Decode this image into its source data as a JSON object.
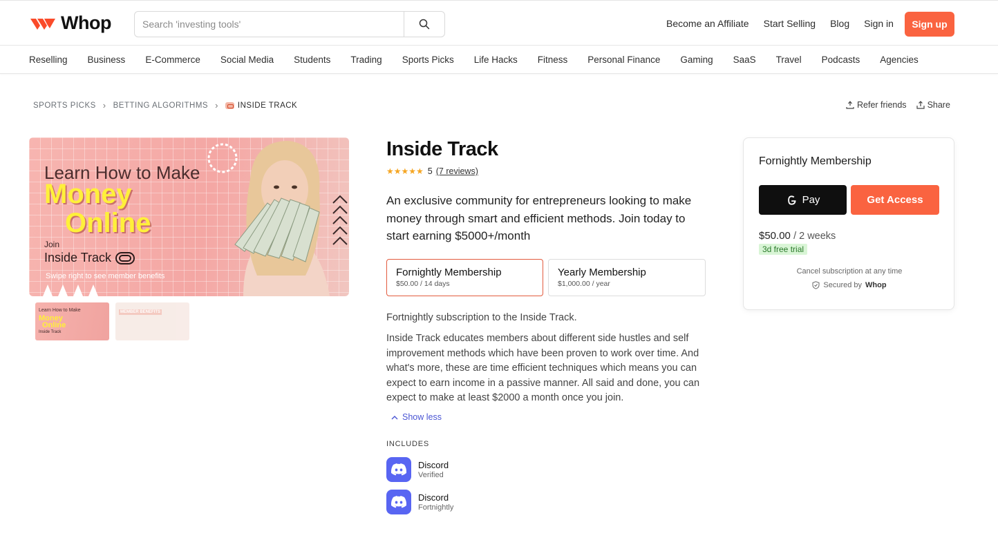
{
  "header": {
    "logo_text": "Whop",
    "search_placeholder": "Search 'investing tools'",
    "nav": [
      "Become an Affiliate",
      "Start Selling",
      "Blog",
      "Sign in"
    ],
    "signup_label": "Sign up",
    "accent_color": "#fa6340"
  },
  "categories": [
    "Reselling",
    "Business",
    "E-Commerce",
    "Social Media",
    "Students",
    "Trading",
    "Sports Picks",
    "Life Hacks",
    "Fitness",
    "Personal Finance",
    "Gaming",
    "SaaS",
    "Travel",
    "Podcasts",
    "Agencies"
  ],
  "breadcrumb": [
    "SPORTS PICKS",
    "BETTING ALGORITHMS",
    "INSIDE TRACK"
  ],
  "actions": {
    "refer": "Refer friends",
    "share": "Share"
  },
  "hero": {
    "line1": "Learn How to Make",
    "money": "Money",
    "online": "Online",
    "join": "Join",
    "track": "Inside Track",
    "swipe": "Swipe right to see member benefits"
  },
  "thumbs": {
    "t1a": "Learn How to Make",
    "t1b": "Money",
    "t1c": "Online",
    "t1d": "Inside Track",
    "t2a": "MEMBER BENEFITS"
  },
  "product": {
    "title": "Inside Track",
    "rating": "5",
    "reviews": "(7 reviews)",
    "tagline": "An exclusive community for entrepreneurs looking to make money through smart and efficient methods. Join today to start earning $5000+/month"
  },
  "plans": [
    {
      "name": "Fornightly Membership",
      "price": "$50.00 / 14 days"
    },
    {
      "name": "Yearly Membership",
      "price": "$1,000.00 / year"
    }
  ],
  "description": {
    "short": "Fortnightly subscription to the Inside Track.",
    "long": "Inside Track educates members about different side hustles and self improvement methods which have been proven to work over time. And what's more, these are time efficient techniques which means you can expect to earn income in a passive manner. All said and done, you can expect to make at least $2000 a month once you join.",
    "toggle": "Show less"
  },
  "includes": {
    "heading": "INCLUDES",
    "items": [
      {
        "name": "Discord",
        "sub": "Verified"
      },
      {
        "name": "Discord",
        "sub": "Fortnightly"
      }
    ]
  },
  "card": {
    "title": "Fornightly Membership",
    "gpay": "Pay",
    "access": "Get Access",
    "price": "$50.00",
    "period": "/ 2 weeks",
    "trial": "3d free trial",
    "cancel": "Cancel subscription at any time",
    "secured": "Secured by",
    "secured_brand": "Whop"
  }
}
